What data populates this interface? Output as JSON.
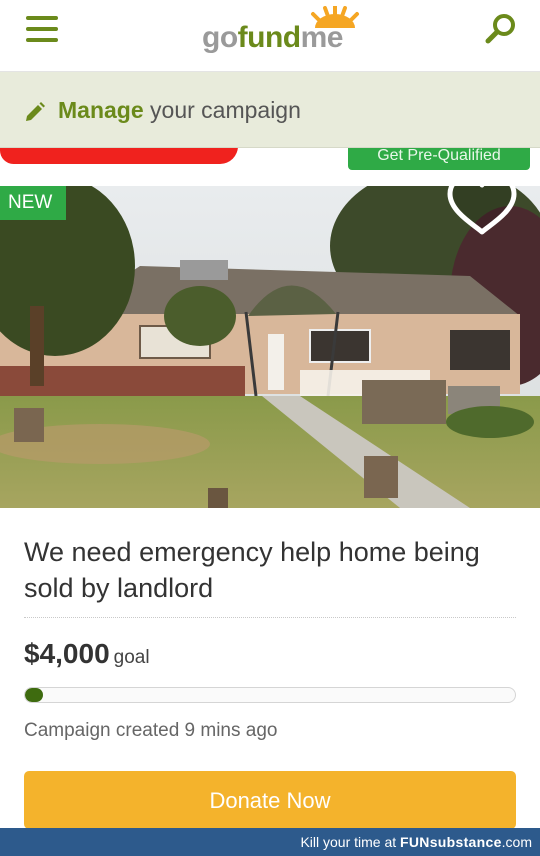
{
  "header": {
    "menu_icon": "hamburger-icon",
    "logo": {
      "go": "go",
      "fund": "fund",
      "me": "me"
    },
    "search_icon": "search-icon",
    "brand_color": "#6b8a1b"
  },
  "manage": {
    "icon": "pencil-icon",
    "bold": "Manage",
    "rest": " your campaign"
  },
  "ad": {
    "green_label": "Get Pre-Qualified"
  },
  "campaign": {
    "badge": "NEW",
    "favorite_icon": "heart-icon",
    "image_alt": "house photo",
    "title": "We need emergency help home being sold by landlord",
    "goal_amount": "$4,000",
    "goal_label": "goal",
    "progress_fraction": 0.02,
    "created": "Campaign created 9 mins ago",
    "donate_label": "Donate Now",
    "donate_color": "#f4b32c"
  },
  "footer": {
    "prefix": "Kill your time at ",
    "brand": "FUNsubstance",
    "suffix": ".com",
    "color": "#2d5a8c"
  }
}
